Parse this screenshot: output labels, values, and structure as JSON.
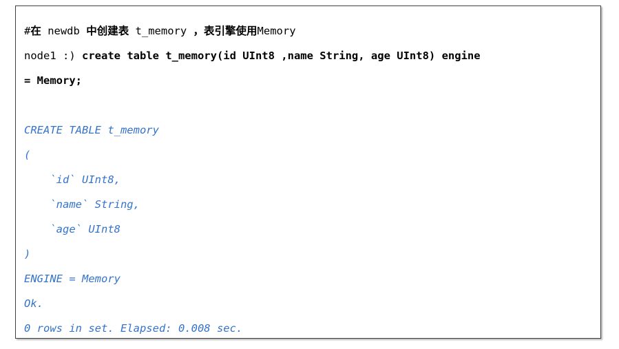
{
  "panel": {
    "border_color": "#3f3f3f",
    "background": "#ffffff",
    "output_color": "#3573cb",
    "command_color": "#000000"
  },
  "comment": {
    "hash": "#",
    "seg1_cjk": "在",
    "seg2_latin": " newdb ",
    "seg3_cjk": "中创建表",
    "seg4_latin": " t_memory ",
    "seg5_cjk": "，表引擎使用",
    "seg6_latin": "Memory"
  },
  "command": {
    "prompt": "node1 :) ",
    "line1": "create table t_memory(id UInt8 ,name String, age UInt8) engine",
    "line2": "= Memory;"
  },
  "output": {
    "lines": [
      "CREATE TABLE t_memory",
      "(",
      "    `id` UInt8,",
      "    `name` String,",
      "    `age` UInt8",
      ")",
      "ENGINE = Memory",
      "Ok.",
      "0 rows in set. Elapsed: 0.008 sec."
    ]
  }
}
